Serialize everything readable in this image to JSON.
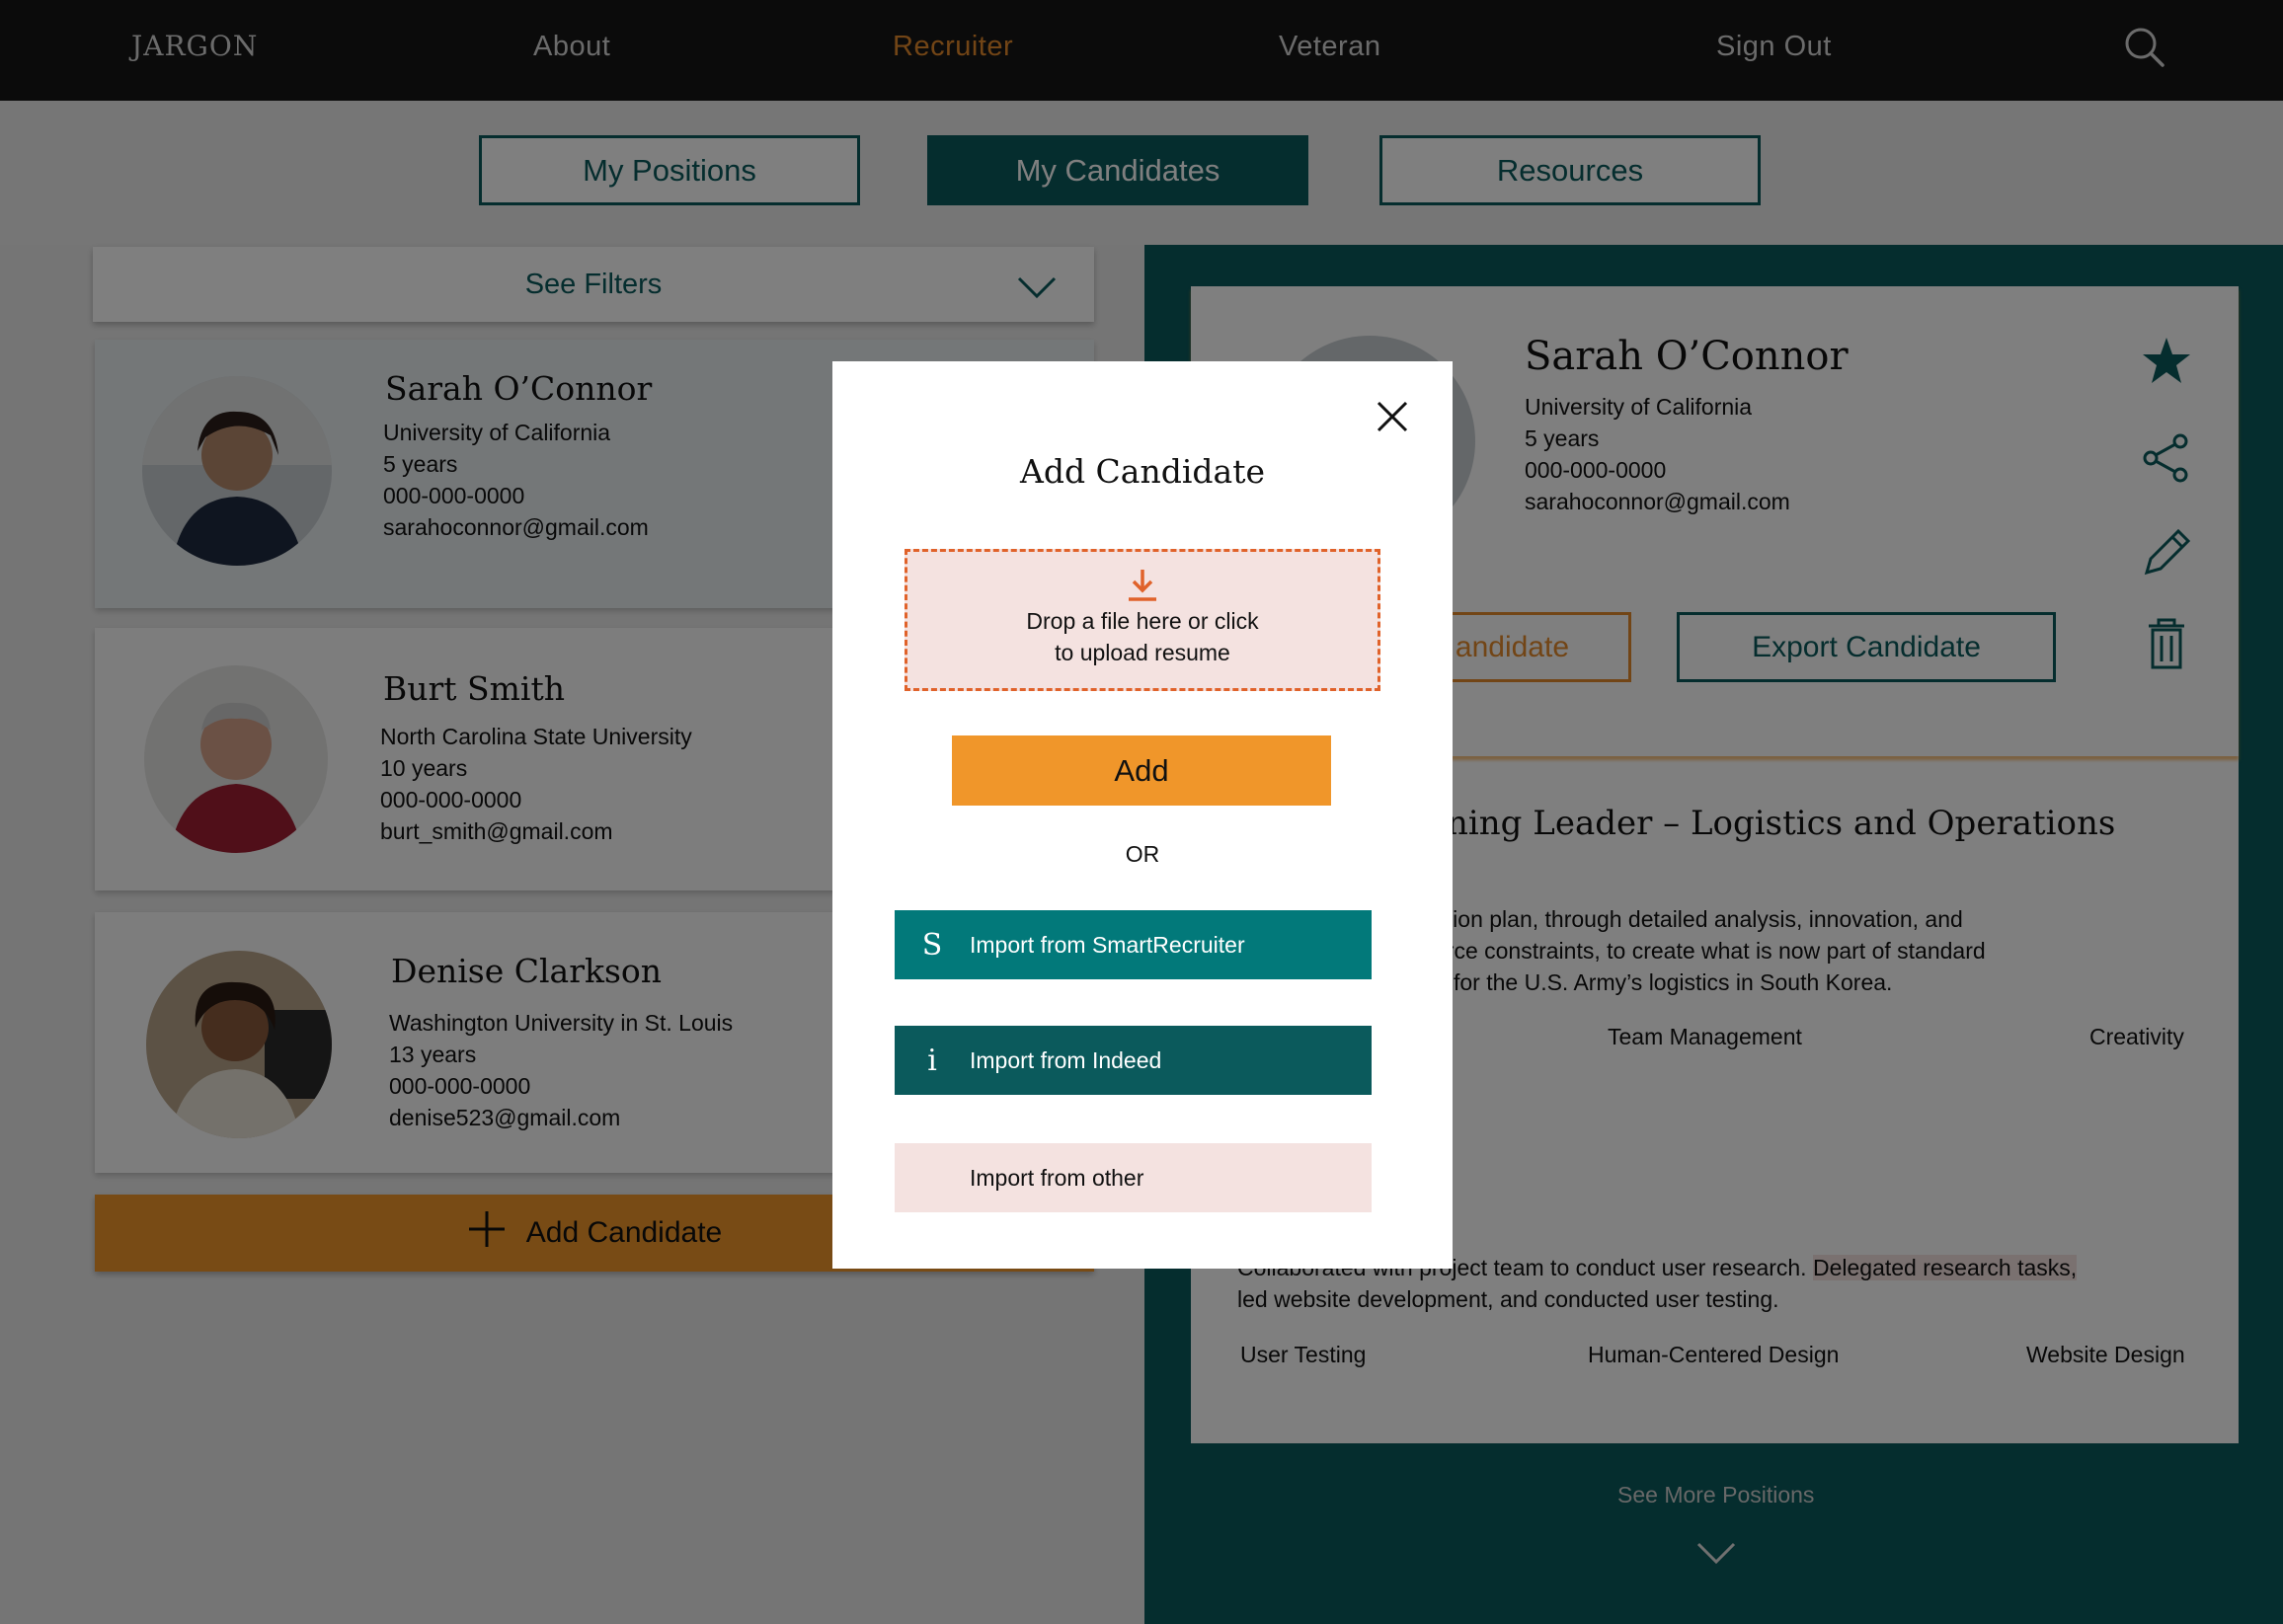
{
  "nav": {
    "brand": "JARGON",
    "items": [
      "About",
      "Recruiter",
      "Veteran",
      "Sign Out"
    ],
    "active": "Recruiter"
  },
  "subnav": {
    "tabs": [
      "My Positions",
      "My Candidates",
      "Resources"
    ],
    "active": "My Candidates"
  },
  "filters": {
    "label": "See Filters"
  },
  "candidates": [
    {
      "name": "Sarah O’Connor",
      "school": "University of California",
      "experience": "5 years",
      "phone": "000-000-0000",
      "email": "sarahoconnor@gmail.com"
    },
    {
      "name": "Burt Smith",
      "school": "North Carolina State University",
      "experience": "10 years",
      "phone": "000-000-0000",
      "email": "burt_smith@gmail.com"
    },
    {
      "name": "Denise Clarkson",
      "school": "Washington University in St. Louis",
      "experience": "13 years",
      "phone": "000-000-0000",
      "email": "denise523@gmail.com"
    }
  ],
  "add_candidate_bar": {
    "label": "Add Candidate"
  },
  "detail": {
    "name": "Sarah O’Connor",
    "school": "University of California",
    "experience": "5 years",
    "phone": "000-000-0000",
    "email": "sarahoconnor@gmail.com",
    "remove_label": "andidate",
    "export_label": "Export Candidate",
    "position_title": "ning Leader – Logistics and Operations",
    "position_desc": [
      "ation plan, through detailed analysis, innovation, and",
      "urce constraints, to create what is now part of standard",
      "for the U.S. Army’s logistics in South Korea."
    ],
    "skills1": [
      "Team Management",
      "Creativity"
    ],
    "position2_desc_a": "Collaborated with project team to conduct user research. ",
    "position2_desc_highlight": "Delegated research tasks,",
    "position2_desc_b": "led website development, and conducted user testing.",
    "skills2": [
      "User Testing",
      "Human-Centered Design",
      "Website Design"
    ],
    "see_more": "See More Positions"
  },
  "modal": {
    "title": "Add Candidate",
    "drop_line1": "Drop a file here or click",
    "drop_line2": "to upload resume",
    "add_button": "Add",
    "or": "OR",
    "imports": [
      {
        "letter": "S",
        "label": "Import from SmartRecruiter"
      },
      {
        "letter": "i",
        "label": "Import from Indeed"
      },
      {
        "letter": "",
        "label": "Import from other"
      }
    ]
  },
  "colors": {
    "teal_dark": "#0b5a5c",
    "teal": "#02797a",
    "orange": "#f0962a",
    "dropzone_bg": "#f4e2e0",
    "dropzone_border": "#e0622a",
    "nav_bg": "#161616"
  }
}
